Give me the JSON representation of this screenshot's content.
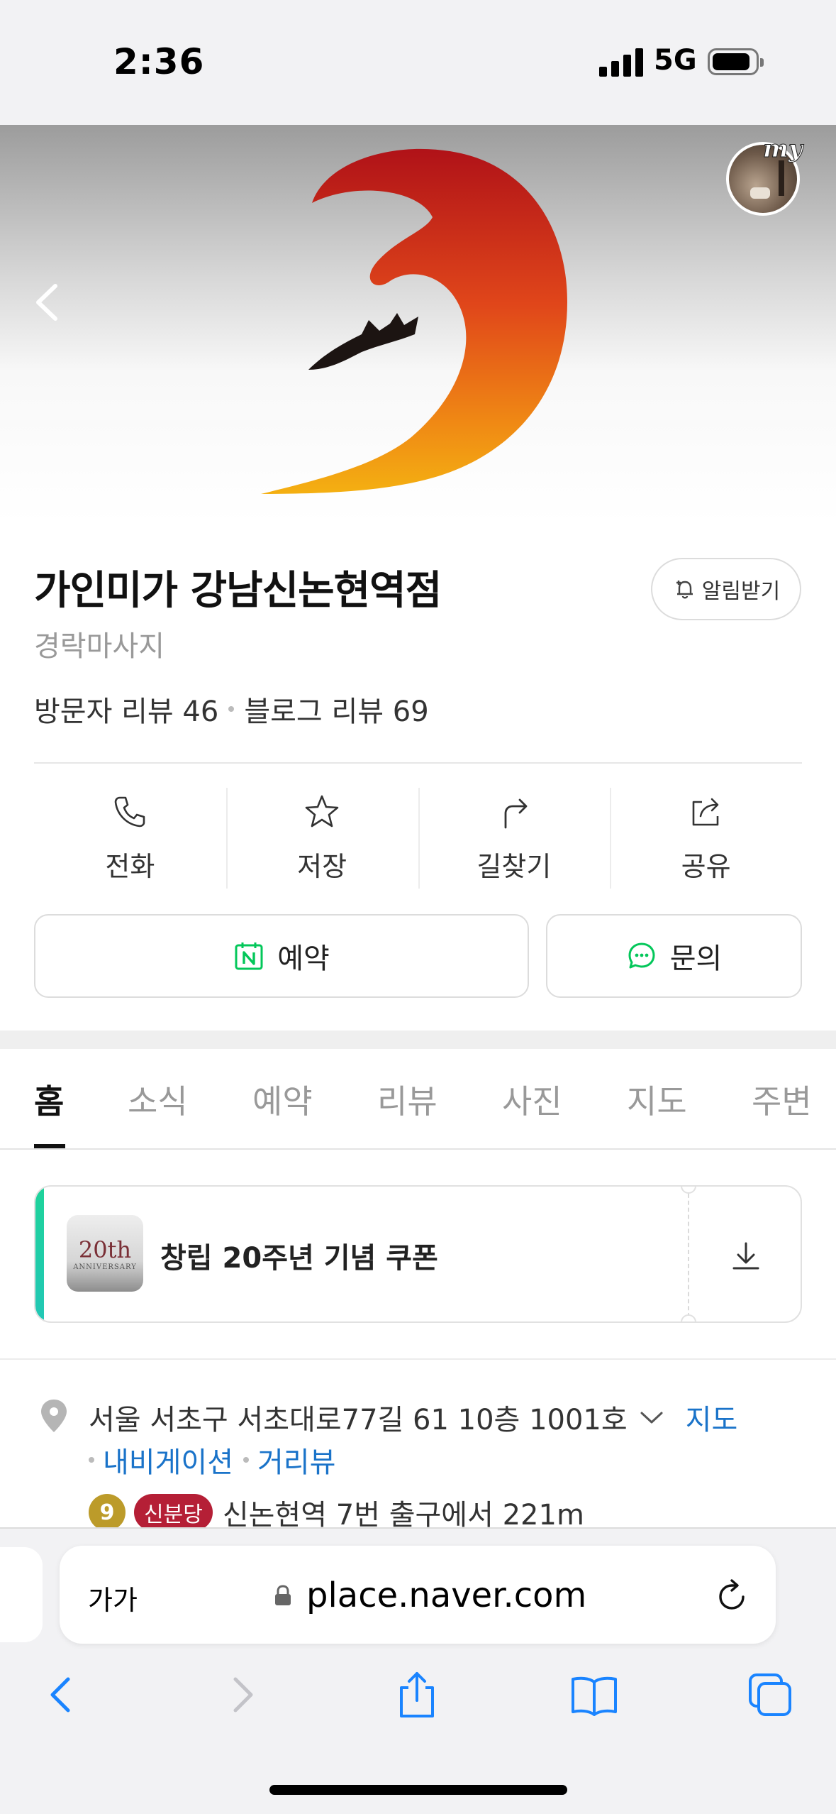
{
  "status_bar": {
    "time": "2:36",
    "network": "5G"
  },
  "hero": {
    "profile_badge": "my"
  },
  "place": {
    "name": "가인미가 강남신논현역점",
    "category": "경락마사지",
    "alarm_label": "알림받기",
    "visitor_reviews": "방문자 리뷰 46",
    "blog_reviews": "블로그 리뷰 69"
  },
  "actions": [
    {
      "label": "전화",
      "icon": "phone-icon"
    },
    {
      "label": "저장",
      "icon": "star-icon"
    },
    {
      "label": "길찾기",
      "icon": "directions-icon"
    },
    {
      "label": "공유",
      "icon": "share-icon"
    }
  ],
  "buttons": {
    "reserve": "예약",
    "inquiry": "문의"
  },
  "tabs": [
    "홈",
    "소식",
    "예약",
    "리뷰",
    "사진",
    "지도",
    "주변"
  ],
  "active_tab": "홈",
  "coupon": {
    "thumb_big": "20th",
    "thumb_small": "ANNIVERSARY",
    "title": "창립 20주년 기념 쿠폰"
  },
  "address": {
    "text": "서울 서초구 서초대로77길 61 10층 1001호",
    "map_link": "지도",
    "navigation_link": "내비게이션",
    "street_view_link": "거리뷰",
    "subway_line_number": "9",
    "subway_line_name": "신분당",
    "station_text": "신논현역 7번 출구에서 221m"
  },
  "safari": {
    "text_size_label": "가가",
    "url": "place.naver.com"
  },
  "colors": {
    "naver_green": "#03c75a",
    "link_blue": "#1a73c9",
    "safari_blue": "#1a84ff",
    "line9": "#bc9b2a",
    "sinbundang": "#b51f36"
  }
}
